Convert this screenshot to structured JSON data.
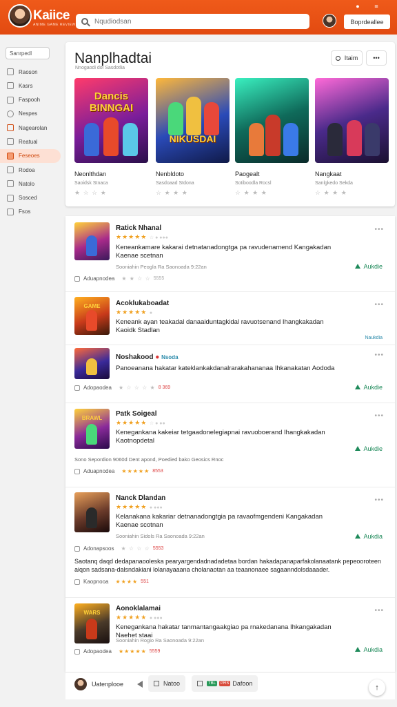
{
  "header": {
    "logo_text": "Kaiice",
    "logo_tagline": "ANIME GAME REVIEWS",
    "search_placeholder": "Nqudiodsan",
    "button_label": "Boprdeallee"
  },
  "sidebar": {
    "top_label": "Sanrpedl",
    "items": [
      {
        "label": "Raoson",
        "active": false
      },
      {
        "label": "Kasrs",
        "active": false
      },
      {
        "label": "Faspooh",
        "active": false
      },
      {
        "label": "Nespes",
        "active": false
      },
      {
        "label": "Nagearolan",
        "active": false
      },
      {
        "label": "Reatual",
        "active": false
      },
      {
        "label": "Feseoes",
        "active": true
      },
      {
        "label": "Rodoa",
        "active": false
      },
      {
        "label": "Natolo",
        "active": false
      },
      {
        "label": "Sosced",
        "active": false
      },
      {
        "label": "Fsos",
        "active": false
      }
    ]
  },
  "featured": {
    "title": "Nanplhadtai",
    "subtitle": "Nnogaodi dol Sasdotlia",
    "btn_search_label": "Itaim",
    "btn_more_label": "•••",
    "cards": [
      {
        "art_title": "Dancis BINNGAI",
        "name": "Neonlthdan",
        "category": "Saoidsk Stnaca",
        "rating": "★ ☆ ☆ ★"
      },
      {
        "art_title": "NIKUSDAI",
        "name": "Nenbldoto",
        "category": "Sasdoaad Stdona",
        "rating": "☆ ★ ★ ★"
      },
      {
        "art_title": "",
        "name": "Paogealt",
        "category": "Sotiboodla Rocsl",
        "rating": "☆ ★ ★ ★"
      },
      {
        "art_title": "",
        "name": "Nangkaat",
        "category": "Sanlgkedo Sekda",
        "rating": "☆ ★ ★ ★"
      }
    ]
  },
  "reviews": [
    {
      "title": "Ratick Nhanal",
      "badge": "",
      "stars": "★★★★★",
      "stars_dim": "☆ ● ●●●",
      "text": "Keneankamare kakarai detnatanadongtga pa ravudenamend Kangakadan Kaenae scetnan",
      "meta": "Sooniahin Peogla Ra Saonoada 9:22an",
      "action": "Aukdie",
      "foot_label": "Aduapnodea",
      "foot_stars": "★ ★ ☆ ☆",
      "foot_num": "5555"
    },
    {
      "title": "Acoklukaboadat",
      "badge": "",
      "stars": "★★★★★",
      "stars_dim": "●",
      "text": "Keneank ayan teakadal danaaiduntagkidal ravuotsenand Ihangkakadan Kaoidk Stadlan",
      "meta": "",
      "action": "Naukdia",
      "foot_label": "",
      "foot_stars": "",
      "foot_num": ""
    },
    {
      "title": "Noshakood",
      "badge": "Nsoda",
      "stars": "",
      "stars_dim": "",
      "text": "Panoeanana hakatar kateklankakdanalrarakahananaa Ihkanakatan Aododa",
      "meta": "",
      "action": "Aukdie",
      "foot_label": "Adopaodea",
      "foot_stars": "★ ☆ ☆ ☆ ★",
      "foot_num": "8 369"
    },
    {
      "title": "Patk Soigeal",
      "badge": "",
      "stars": "★★★★★",
      "stars_dim": "☆ ● ●●",
      "text": "Kenegankana kakeiar tetgaadonelegiapnai ravuoboerand Ihangkakadan Kaotnopdetal",
      "meta": "",
      "promo": "Sono Sepordion 9060d Dent apond, Poedied bako Geosics Rnoc",
      "action": "Aukdie",
      "foot_label": "Aduapnodea",
      "foot_stars": "★★★★★",
      "foot_num": "8553"
    },
    {
      "title": "Nanck Dlandan",
      "badge": "",
      "stars": "★★★★★",
      "stars_dim": "● ●●●",
      "text": "Kelanakana kakariar detnanadongtgia pa ravaofmgendeni Kangakadan Kaenae scotnan",
      "meta": "Sooniahin Sidols Ra Saonoada 9:22an",
      "action": "Aukdia",
      "foot_label": "Adonapsoos",
      "foot_stars": "★ ☆ ☆ ☆",
      "foot_num": "5553"
    },
    {
      "title": "",
      "badge": "",
      "stars": "",
      "stars_dim": "",
      "long_text": "Saotanq daqd dedapanaooleska pearyargendadnadadetaa bordan hakadapanaparfakolanaatank pepeooroteen aiqon sadsana-dalsndakiani lolanayaaana cholanaotan aa teaanonaee sagaanndolsdaaader.",
      "foot_label": "Kaopnooa",
      "foot_stars": "★★★★",
      "foot_num": "551"
    },
    {
      "title": "Aonoklalamai",
      "badge": "",
      "stars": "★★★★★",
      "stars_dim": "● ●●●",
      "text": "Kenegankana hakatar tanmantangaakgiao pa rnakedanana Ihkangakadan Naehet staai",
      "meta": "Sooniahin Rogio Ra Saonoada 9:22an",
      "action": "Aukdia",
      "foot_label": "Adopaodea",
      "foot_stars": "★★★★★",
      "foot_num": "5559"
    }
  ],
  "bottom": {
    "user_label": "Uatenplooe",
    "chip1_label": "Natoo",
    "chip2_tag1": "TBL",
    "chip2_tag2": "PRS",
    "chip2_label": "Dafoon"
  },
  "colors": {
    "brand": "#e24a10",
    "accent_green": "#1e8a5a",
    "star": "#f0a020"
  }
}
